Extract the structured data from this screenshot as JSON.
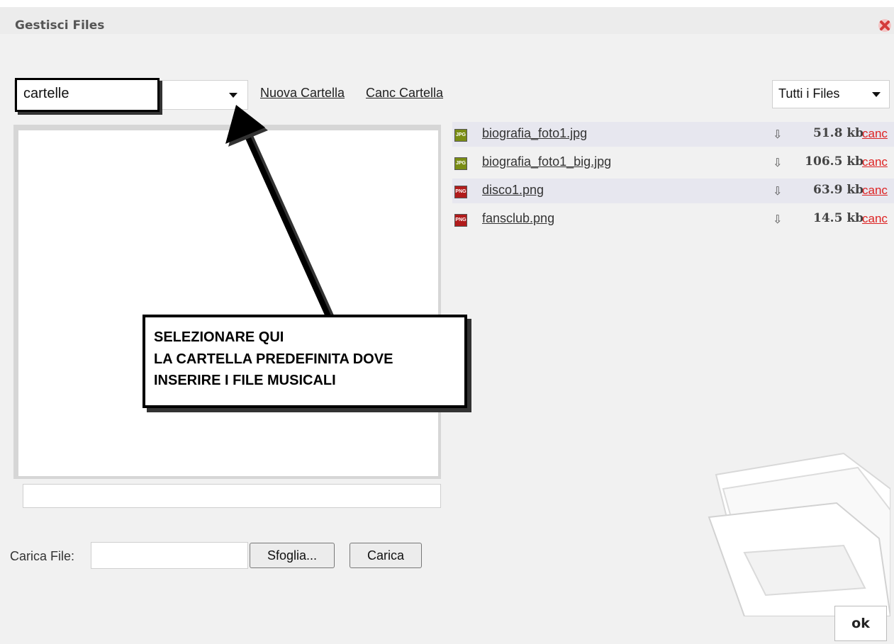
{
  "dialog": {
    "title": "Gestisci Files",
    "close_icon": "close-icon"
  },
  "folder_select": {
    "value": "cartelle"
  },
  "links": {
    "new_folder": "Nuova Cartella",
    "delete_folder": "Canc Cartella"
  },
  "filter_select": {
    "value": "Tutti i Files"
  },
  "files": [
    {
      "type": "JPG",
      "name": "biografia_foto1.jpg",
      "size": "51.8 kb",
      "delete": "canc"
    },
    {
      "type": "JPG",
      "name": "biografia_foto1_big.jpg",
      "size": "106.5 kb",
      "delete": "canc"
    },
    {
      "type": "PNG",
      "name": "disco1.png",
      "size": "63.9 kb",
      "delete": "canc"
    },
    {
      "type": "PNG",
      "name": "fansclub.png",
      "size": "14.5 kb",
      "delete": "canc"
    }
  ],
  "callout": {
    "lines": [
      "SELEZIONARE QUI",
      "LA CARTELLA PREDEFINITA DOVE",
      "INSERIRE I FILE MUSICALI"
    ]
  },
  "upload": {
    "label": "Carica File:",
    "browse_label": "Sfoglia...",
    "upload_label": "Carica"
  },
  "ok_label": "ok",
  "colors": {
    "delete_link": "#dd2222",
    "jpg_badge": "#7a8d14",
    "png_badge": "#b11b1b",
    "row_alt": "#e7e7ef"
  }
}
